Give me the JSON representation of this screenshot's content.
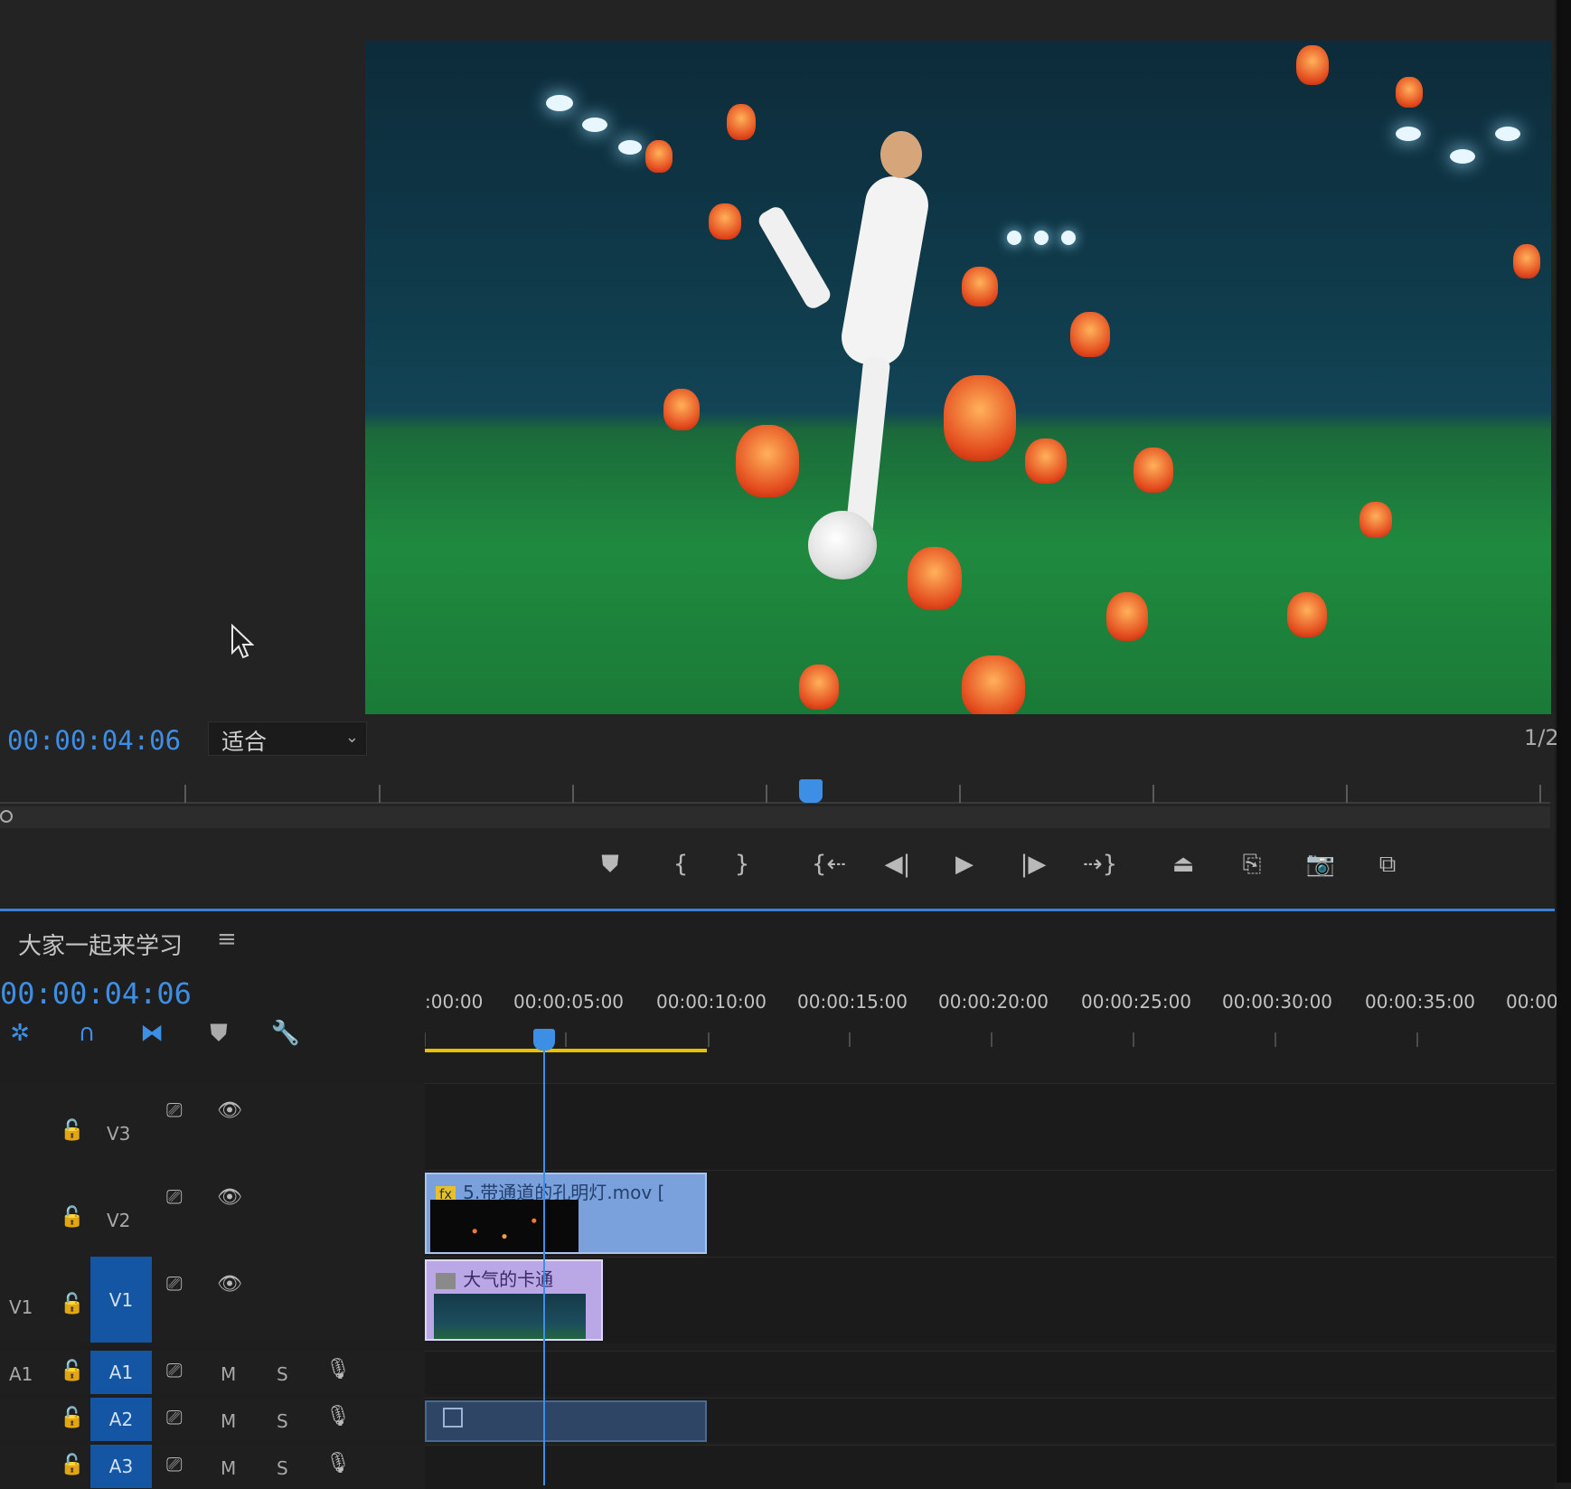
{
  "program_monitor": {
    "timecode": "00:00:04:06",
    "fit_select": "适合",
    "page_fraction": "1/2",
    "transport": {
      "marker": "marker-icon",
      "mark_in": "mark-in-icon",
      "mark_out": "mark-out-icon",
      "go_to_in": "go-to-in-icon",
      "step_back": "step-back-icon",
      "play": "play-icon",
      "step_forward": "step-forward-icon",
      "go_to_out": "go-to-out-icon",
      "lift": "lift-icon",
      "extract": "extract-icon",
      "export_frame": "camera-icon",
      "comparison": "comparison-view-icon"
    }
  },
  "timeline": {
    "sequence_name": "大家一起来学习",
    "menu_glyph": "≡",
    "timecode": "00:00:04:06",
    "ruler_labels": [
      ":00:00",
      "00:00:05:00",
      "00:00:10:00",
      "00:00:15:00",
      "00:00:20:00",
      "00:00:25:00",
      "00:00:30:00",
      "00:00:35:00",
      "00:00:0"
    ],
    "tracks": {
      "v3": {
        "name": "V3"
      },
      "v2": {
        "name": "V2"
      },
      "v1": {
        "source": "V1",
        "name": "V1"
      },
      "a1": {
        "source": "A1",
        "name": "A1",
        "m": "M",
        "s": "S"
      },
      "a2": {
        "name": "A2",
        "m": "M",
        "s": "S"
      },
      "a3": {
        "name": "A3",
        "m": "M",
        "s": "S"
      }
    },
    "clips": {
      "v2_clip": {
        "badge": "fx",
        "label": "5.带通道的孔明灯.mov ["
      },
      "v1_clip": {
        "label": "大气的卡通"
      }
    }
  }
}
